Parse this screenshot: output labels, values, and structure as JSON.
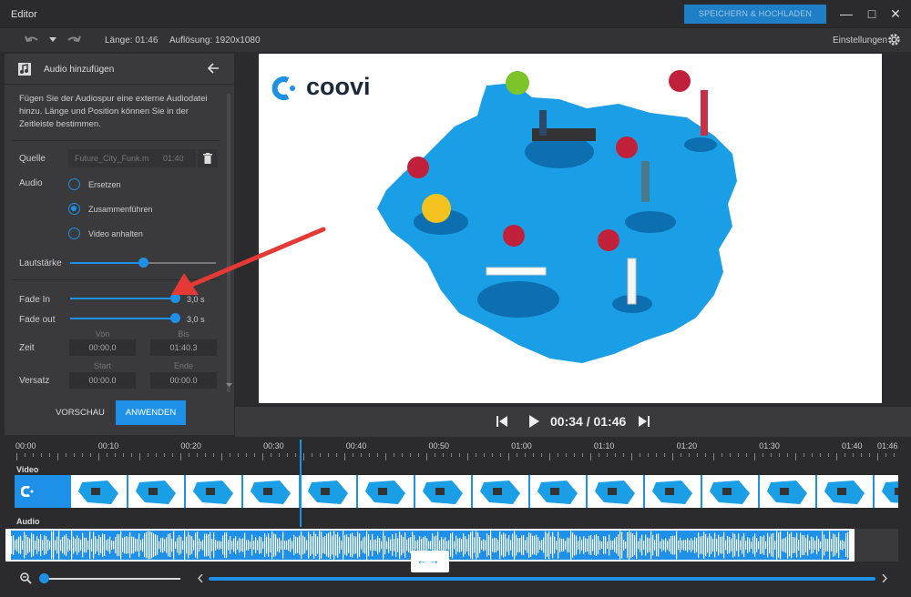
{
  "window": {
    "title": "Editor",
    "save_label": "SPEICHERN & HOCHLADEN"
  },
  "toolbar": {
    "length": "Länge: 01:46",
    "resolution": "Auflösung: 1920x1080",
    "settings_label": "Einstellungen"
  },
  "panel": {
    "title": "Audio hinzufügen",
    "description": "Fügen Sie der Audiospur eine externe Audiodatei hinzu. Länge und Position können Sie in der Zeitleiste bestimmen.",
    "source_label": "Quelle",
    "source_file": "Future_City_Funk.m",
    "source_duration": "01:40",
    "audio_label": "Audio",
    "audio_options": [
      "Ersetzen",
      "Zusammenführen",
      "Video anhalten"
    ],
    "audio_selected": "Zusammenführen",
    "volume_label": "Lautstärke",
    "volume_level": 0.5,
    "fade_in_label": "Fade In",
    "fade_in_value": "3,0 s",
    "fade_out_label": "Fade out",
    "fade_out_value": "3,0 s",
    "time_label": "Zeit",
    "from_header": "Von",
    "to_header": "Bis",
    "time_from": "00:00.0",
    "time_to": "01:40.3",
    "offset_label": "Versatz",
    "start_header": "Start",
    "end_header": "Ende",
    "offset_start": "00:00.0",
    "offset_end": "00:00.0",
    "preview_button": "VORSCHAU",
    "apply_button": "ANWENDEN"
  },
  "preview": {
    "logo_text": "coovi"
  },
  "player": {
    "time": "00:34 / 01:46"
  },
  "timeline": {
    "ticks": [
      "00:00",
      "00:10",
      "00:20",
      "00:30",
      "00:40",
      "00:50",
      "01:00",
      "01:10",
      "01:20",
      "01:30",
      "01:40",
      "01:46"
    ],
    "video_label": "Video",
    "audio_label": "Audio",
    "playhead_time_fraction": 0.32
  },
  "colors": {
    "accent": "#1e90e8",
    "map": "#1a9ee6",
    "arrow": "#e53935",
    "question": "#c0203a"
  }
}
